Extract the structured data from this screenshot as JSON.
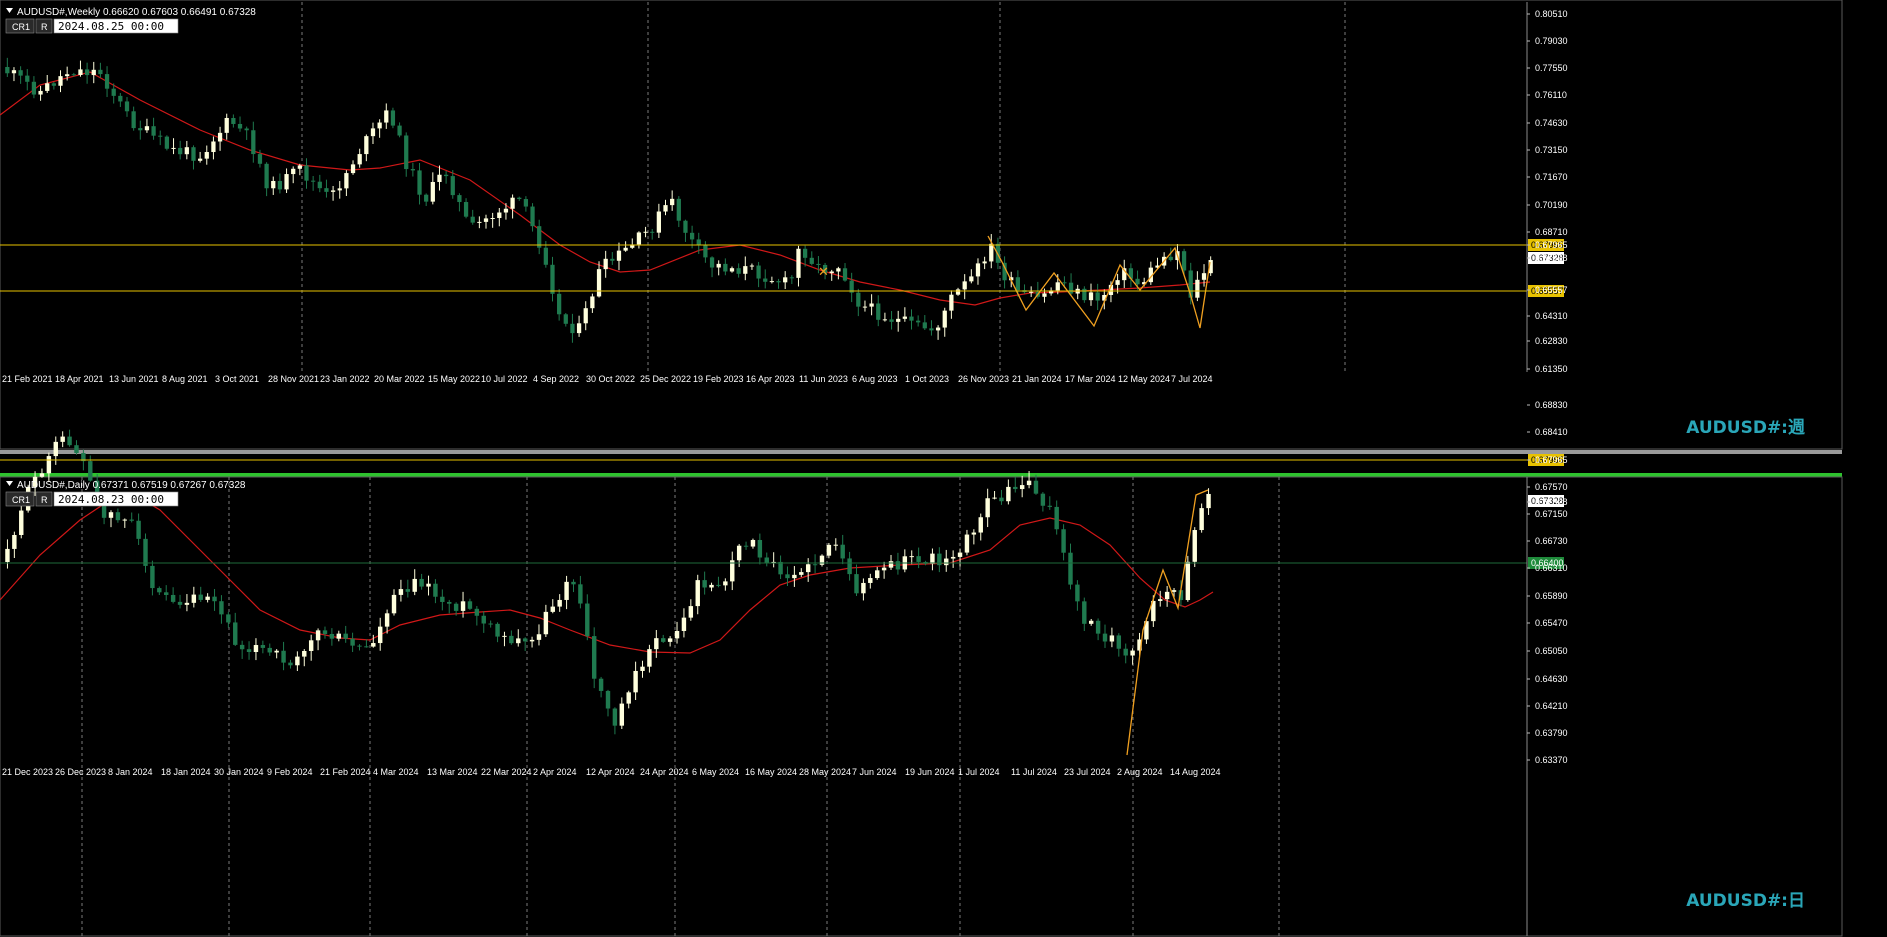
{
  "colors": {
    "background": "#000000",
    "bull": "#ffffdd",
    "bear": "#1f7a4f",
    "ma": "#d01818",
    "level": "#e8c200",
    "zigzag": "#f0a020",
    "grid": "#7a7a7a",
    "axis_text": "#ffffff",
    "watermark": "#2aa6b8",
    "separator": "#2ec22e",
    "daily_green_level": "#1e6a3a"
  },
  "weekly": {
    "header": "AUDUSD#,Weekly  0.66620 0.67603 0.66491 0.67328",
    "cr_label": "CR1",
    "r_label": "R",
    "date_box": "2024.08.25 00:00",
    "watermark": "AUDUSD#:週",
    "price_ticks": [
      "0.80510",
      "0.79030",
      "0.77550",
      "0.76110",
      "0.74630",
      "0.73150",
      "0.71670",
      "0.70190",
      "0.68710",
      "0.67965",
      "0.67328",
      "0.65557",
      "0.64310",
      "0.62830",
      "0.61350"
    ],
    "price_labels": [
      {
        "text": "0.67965",
        "style": "level"
      },
      {
        "text": "0.67328",
        "style": "current"
      },
      {
        "text": "0.65557",
        "style": "level"
      }
    ],
    "date_ticks": [
      "21 Feb 2021",
      "18 Apr 2021",
      "13 Jun 2021",
      "8 Aug 2021",
      "3 Oct 2021",
      "28 Nov 2021",
      "23 Jan 2022",
      "20 Mar 2022",
      "15 May 2022",
      "10 Jul 2022",
      "4 Sep 2022",
      "30 Oct 2022",
      "25 Dec 2022",
      "19 Feb 2023",
      "16 Apr 2023",
      "11 Jun 2023",
      "6 Aug 2023",
      "1 Oct 2023",
      "26 Nov 2023",
      "21 Jan 2024",
      "17 Mar 2024",
      "12 May 2024",
      "7 Jul 2024"
    ]
  },
  "daily": {
    "header": "AUDUSD#,Daily  0.67371 0.67519 0.67267 0.67328",
    "cr_label": "CR1",
    "r_label": "R",
    "date_box": "2024.08.23 00:00",
    "watermark": "AUDUSD#:日",
    "price_ticks": [
      "0.68830",
      "0.68410",
      "0.67965",
      "0.67570",
      "0.67328",
      "0.67150",
      "0.66730",
      "0.66310",
      "0.65890",
      "0.65470",
      "0.65050",
      "0.64630",
      "0.64210",
      "0.63790",
      "0.63370"
    ],
    "price_labels": [
      {
        "text": "0.67965",
        "style": "level"
      },
      {
        "text": "0.67328",
        "style": "current"
      },
      {
        "text": "0.66400",
        "style": "green"
      }
    ],
    "date_ticks": [
      "21 Dec 2023",
      "26 Dec 2023",
      "8 Jan 2024",
      "18 Jan 2024",
      "30 Jan 2024",
      "9 Feb 2024",
      "21 Feb 2024",
      "4 Mar 2024",
      "13 Mar 2024",
      "22 Mar 2024",
      "2 Apr 2024",
      "12 Apr 2024",
      "24 Apr 2024",
      "6 May 2024",
      "16 May 2024",
      "28 May 2024",
      "7 Jun 2024",
      "19 Jun 2024",
      "1 Jul 2024",
      "11 Jul 2024",
      "23 Jul 2024",
      "2 Aug 2024",
      "14 Aug 2024"
    ]
  }
}
